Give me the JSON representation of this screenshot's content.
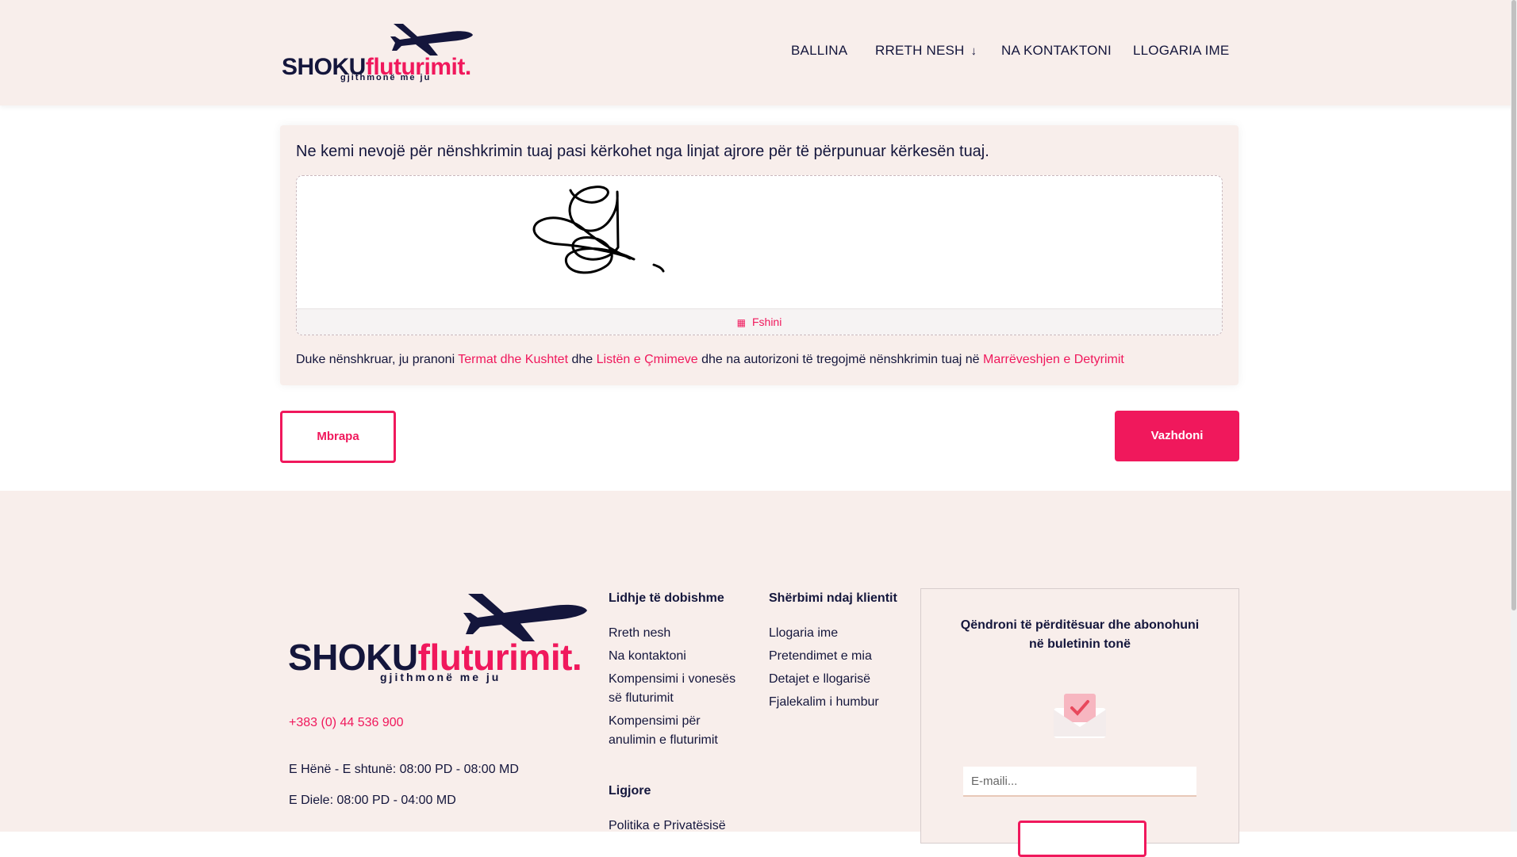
{
  "brand": {
    "part1": "SHOKU",
    "part2": "fluturimit.",
    "tagline": "gjithmonë me ju"
  },
  "nav": {
    "home": "BALLINA",
    "about": "RRETH NESH",
    "contact": "NA KONTAKTONI",
    "account": "LLOGARIA IME"
  },
  "signature": {
    "prompt": "Ne kemi nevojë për nënshkrimin tuaj pasi kërkohet nga linjat ajrore për të përpunuar kërkesën tuaj.",
    "clear_label": "Fshini",
    "legal": {
      "t1": "Duke nënshkruar, ju pranoni ",
      "link1": "Termat dhe Kushtet",
      "t2": " dhe ",
      "link2": "Listën e Çmimeve",
      "t3": " dhe na autorizoni të tregojmë nënshkrimin tuaj në ",
      "link3": "Marrëveshjen e Detyrimit"
    }
  },
  "actions": {
    "back": "Mbrapa",
    "next": "Vazhdoni"
  },
  "footer": {
    "phone": "+383 (0) 44 536 900",
    "hours1": "E Hënë - E shtunë: 08:00 PD - 08:00 MD",
    "hours2": "E Diele: 08:00 PD - 04:00 MD",
    "col1": {
      "heading": "Lidhje të dobishme",
      "links": [
        "Rreth nesh",
        "Na kontaktoni",
        "Kompensimi i vonesës së fluturimit",
        "Kompensimi për anulimin e fluturimit"
      ]
    },
    "col1b": {
      "heading": "Ligjore",
      "links": [
        "Politika e Privatësisë"
      ]
    },
    "col2": {
      "heading": "Shërbimi ndaj klientit",
      "links": [
        "Llogaria ime",
        "Pretendimet e mia",
        "Detajet e llogarisë",
        "Fjalekalim i humbur"
      ]
    },
    "newsletter": {
      "title": "Qëndroni të përditësuar dhe abonohuni në buletinin tonë",
      "placeholder": "E-maili..."
    }
  },
  "colors": {
    "accent": "#f0185c",
    "navy": "#14163c",
    "bg": "#f8eeeb"
  },
  "icons": {
    "plane": "airplane-icon",
    "clear": "eraser-icon",
    "dropdown": "chevron-down-icon",
    "newsletter": "envelope-heart-icon"
  }
}
